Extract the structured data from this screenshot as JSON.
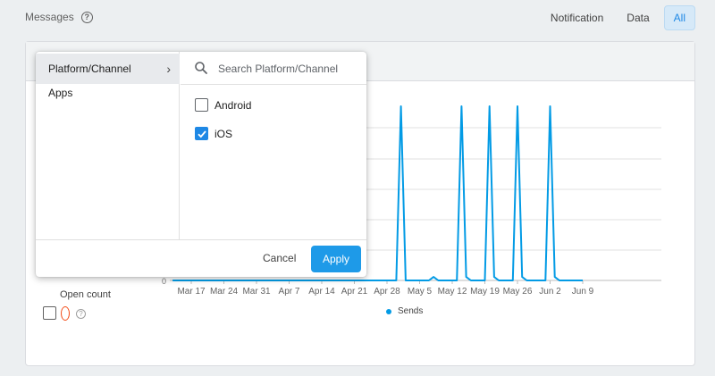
{
  "header": {
    "title": "Messages",
    "tabs": [
      {
        "label": "Notification",
        "active": false
      },
      {
        "label": "Data",
        "active": false
      },
      {
        "label": "All",
        "active": true
      }
    ]
  },
  "filter_popup": {
    "categories": [
      {
        "label": "Platform/Channel",
        "selected": true
      },
      {
        "label": "Apps",
        "selected": false
      }
    ],
    "search_placeholder": "Search Platform/Channel",
    "options": [
      {
        "label": "Android",
        "checked": false
      },
      {
        "label": "iOS",
        "checked": true
      }
    ],
    "cancel_label": "Cancel",
    "apply_label": "Apply"
  },
  "open_count_label": "Open count",
  "chart_data": {
    "type": "line",
    "x_ticks": [
      "Mar 17",
      "Mar 24",
      "Mar 31",
      "Apr 7",
      "Apr 14",
      "Apr 21",
      "Apr 28",
      "May 5",
      "May 12",
      "May 19",
      "May 26",
      "Jun 2",
      "Jun 9"
    ],
    "y_tick_visible": "0",
    "series": [
      {
        "name": "Sends",
        "color": "#039be5",
        "points": [
          [
            "Mar 13",
            0
          ],
          [
            "Mar 17",
            0
          ],
          [
            "Mar 24",
            0
          ],
          [
            "Mar 31",
            0
          ],
          [
            "Apr 7",
            0
          ],
          [
            "Apr 14",
            0
          ],
          [
            "Apr 21",
            0
          ],
          [
            "Apr 28",
            0
          ],
          [
            "Apr 30",
            0
          ],
          [
            "May 1",
            100
          ],
          [
            "May 2",
            0
          ],
          [
            "May 7",
            0
          ],
          [
            "May 8",
            2
          ],
          [
            "May 9",
            0
          ],
          [
            "May 13",
            0
          ],
          [
            "May 14",
            100
          ],
          [
            "May 15",
            2
          ],
          [
            "May 16",
            0
          ],
          [
            "May 19",
            0
          ],
          [
            "May 20",
            100
          ],
          [
            "May 21",
            2
          ],
          [
            "May 22",
            0
          ],
          [
            "May 25",
            0
          ],
          [
            "May 26",
            100
          ],
          [
            "May 27",
            2
          ],
          [
            "May 28",
            0
          ],
          [
            "Jun 1",
            0
          ],
          [
            "Jun 2",
            100
          ],
          [
            "Jun 3",
            2
          ],
          [
            "Jun 4",
            0
          ],
          [
            "Jun 9",
            0
          ]
        ]
      }
    ],
    "legend": "bottom-center"
  }
}
